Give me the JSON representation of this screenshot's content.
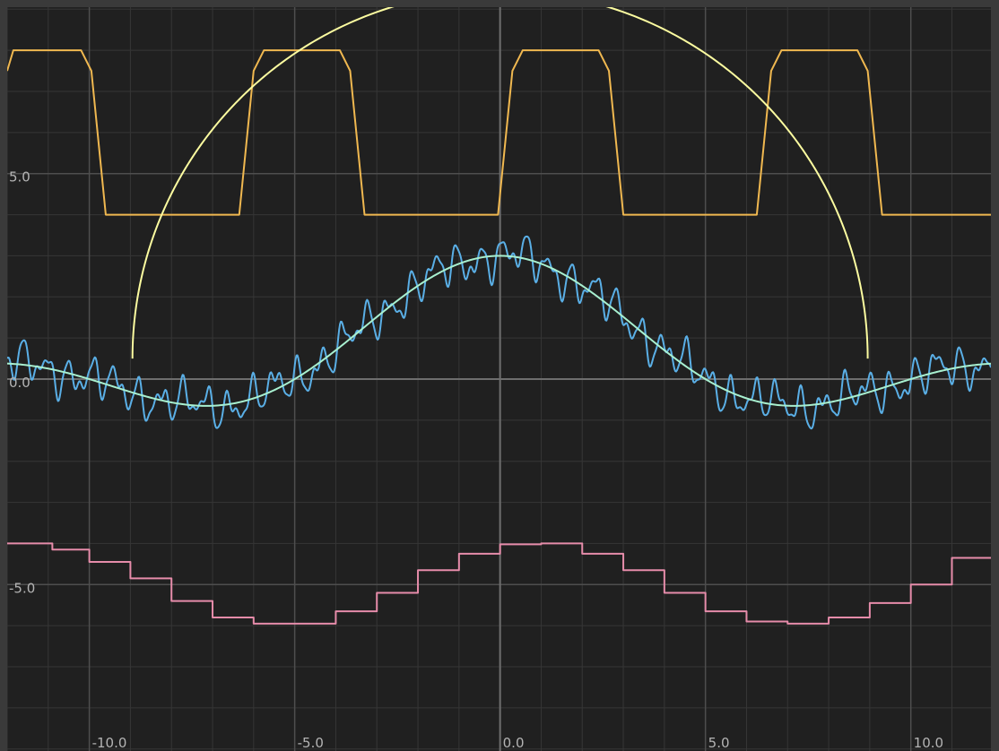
{
  "chart_data": {
    "type": "line",
    "title": "",
    "xlabel": "",
    "ylabel": "",
    "xlim": [
      -12.0,
      11.95
    ],
    "ylim": [
      -9.05,
      9.05
    ],
    "minor_step": 1.0,
    "major_step": 5.0,
    "grid": true,
    "x_tick_labels": [
      {
        "value": -10,
        "label": "-10.0"
      },
      {
        "value": -5,
        "label": "-5.0"
      },
      {
        "value": 0,
        "label": "0.0"
      },
      {
        "value": 5,
        "label": "5.0"
      },
      {
        "value": 10,
        "label": "10.0"
      }
    ],
    "y_tick_labels": [
      {
        "value": 5,
        "label": "5.0"
      },
      {
        "value": 0,
        "label": "0.0"
      },
      {
        "value": -5,
        "label": "-5.0"
      }
    ],
    "series": [
      {
        "color": "#5aafe6",
        "description": "noisy sinc wave",
        "x_range": [
          -12.0,
          11.95
        ],
        "samples": 1200,
        "model": {
          "sinc_amplitude": 3.0,
          "sinc_period": 10.0,
          "noise_amplitude": 0.62
        }
      },
      {
        "color": "#a8f0d0",
        "description": "smooth sinc wave",
        "x_range": [
          -12.0,
          11.95
        ],
        "samples": 600,
        "model": {
          "sinc_amplitude": 3.0,
          "sinc_period": 10.0
        }
      },
      {
        "color": "#f0b850",
        "description": "trapezoid wave",
        "x_range": [
          -12.0,
          11.95
        ],
        "points": [
          [
            -12.0,
            7.5
          ],
          [
            -11.85,
            8.0
          ],
          [
            -10.2,
            8.0
          ],
          [
            -9.95,
            7.5
          ],
          [
            -9.6,
            4.0
          ],
          [
            -6.35,
            4.0
          ],
          [
            -6.0,
            7.5
          ],
          [
            -5.75,
            8.0
          ],
          [
            -3.9,
            8.0
          ],
          [
            -3.65,
            7.5
          ],
          [
            -3.3,
            4.0
          ],
          [
            -0.05,
            4.0
          ],
          [
            0.3,
            7.5
          ],
          [
            0.55,
            8.0
          ],
          [
            2.4,
            8.0
          ],
          [
            2.65,
            7.5
          ],
          [
            3.0,
            4.0
          ],
          [
            6.25,
            4.0
          ],
          [
            6.6,
            7.5
          ],
          [
            6.85,
            8.0
          ],
          [
            8.7,
            8.0
          ],
          [
            8.95,
            7.5
          ],
          [
            9.3,
            4.0
          ],
          [
            11.95,
            4.0
          ]
        ]
      },
      {
        "color": "#fcfca0",
        "description": "semicircle",
        "center": [
          0.0,
          0.5
        ],
        "radius": 8.95
      },
      {
        "color": "#e68caa",
        "description": "step function",
        "steps": [
          [
            -12.0,
            -10.9,
            -4.0
          ],
          [
            -10.9,
            -10.0,
            -4.15
          ],
          [
            -10.0,
            -9.0,
            -4.45
          ],
          [
            -9.0,
            -8.0,
            -4.85
          ],
          [
            -8.0,
            -7.0,
            -5.4
          ],
          [
            -7.0,
            -6.0,
            -5.8
          ],
          [
            -6.0,
            -5.0,
            -5.95
          ],
          [
            -5.0,
            -4.0,
            -5.95
          ],
          [
            -4.0,
            -3.0,
            -5.65
          ],
          [
            -3.0,
            -2.0,
            -5.2
          ],
          [
            -2.0,
            -1.0,
            -4.65
          ],
          [
            -1.0,
            0.0,
            -4.25
          ],
          [
            0.0,
            1.0,
            -4.02
          ],
          [
            1.0,
            2.0,
            -4.0
          ],
          [
            2.0,
            3.0,
            -4.25
          ],
          [
            3.0,
            4.0,
            -4.65
          ],
          [
            4.0,
            5.0,
            -5.2
          ],
          [
            5.0,
            6.0,
            -5.65
          ],
          [
            6.0,
            7.0,
            -5.9
          ],
          [
            7.0,
            8.0,
            -5.95
          ],
          [
            8.0,
            9.0,
            -5.8
          ],
          [
            9.0,
            10.0,
            -5.45
          ],
          [
            10.0,
            11.0,
            -5.0
          ],
          [
            11.0,
            11.95,
            -4.35
          ]
        ]
      }
    ]
  }
}
